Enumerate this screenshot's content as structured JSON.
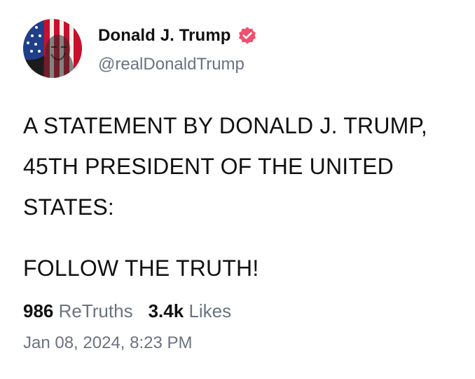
{
  "post": {
    "author": {
      "display_name": "Donald J. Trump",
      "handle": "@realDonaldTrump",
      "avatar_icon": "flag-portrait-avatar",
      "verified_icon": "verified-badge-icon",
      "verified_color": "#f0506e"
    },
    "body": {
      "line1": "A STATEMENT BY DONALD J. TRUMP,",
      "line2": "45TH PRESIDENT OF THE UNITED",
      "line3": "STATES:",
      "line4": "FOLLOW THE TRUTH!"
    },
    "stats": {
      "retruths_count": "986",
      "retruths_label": "ReTruths",
      "likes_count": "3.4k",
      "likes_label": "Likes"
    },
    "timestamp": "Jan 08, 2024, 8:23 PM"
  }
}
